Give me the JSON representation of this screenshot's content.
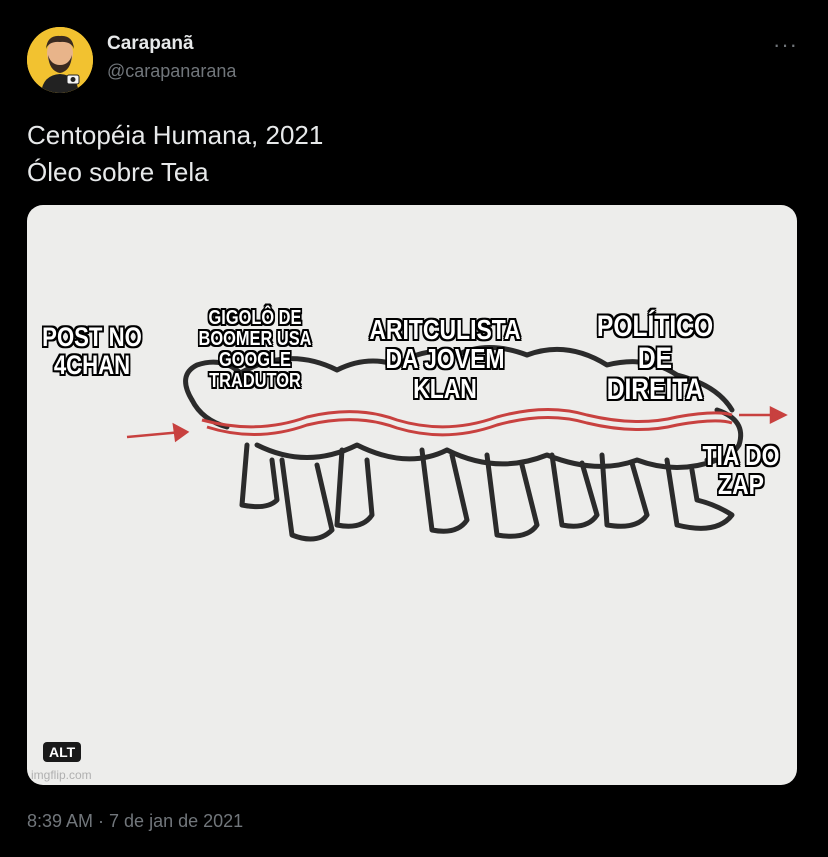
{
  "author": {
    "display_name": "Carapanã",
    "handle": "@carapanarana"
  },
  "menu": {
    "more_label": "···"
  },
  "tweet": {
    "line1": "Centopéia Humana, 2021",
    "line2": "Óleo sobre Tela",
    "timestamp": "8:39 AM · 7 de jan de 2021"
  },
  "media": {
    "labels": {
      "post": "POST NO 4CHAN",
      "gigolo": "GIGOLÔ DE BOOMER USA GOOGLE TRADUTOR",
      "articulista": "ARITCULISTA DA JOVEM KLAN",
      "politico": "POLÍTICO DE DIREITA",
      "tia": "TIA DO ZAP"
    },
    "alt_badge": "ALT",
    "watermark": "imgflip.com"
  },
  "colors": {
    "background": "#000000",
    "text": "#e7e9ea",
    "muted": "#71767b",
    "red_line": "#c8413f"
  }
}
